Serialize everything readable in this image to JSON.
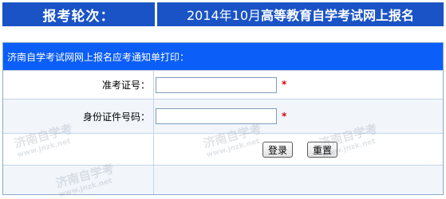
{
  "header": {
    "round_label": "报考轮次：",
    "round_value_prefix": "2014年10月",
    "round_value_main": "高等教育自学考试网上报名"
  },
  "form": {
    "title": "济南自学考试网网上报名应考通知单打印：",
    "fields": [
      {
        "label": "准考证号：",
        "value": "",
        "required_mark": "*"
      },
      {
        "label": "身份证件号码：",
        "value": "",
        "required_mark": "*"
      }
    ],
    "buttons": {
      "login": "登录",
      "reset": "重置"
    }
  },
  "watermark": {
    "text": "济南自学考",
    "site": "www.jnzk.net"
  }
}
